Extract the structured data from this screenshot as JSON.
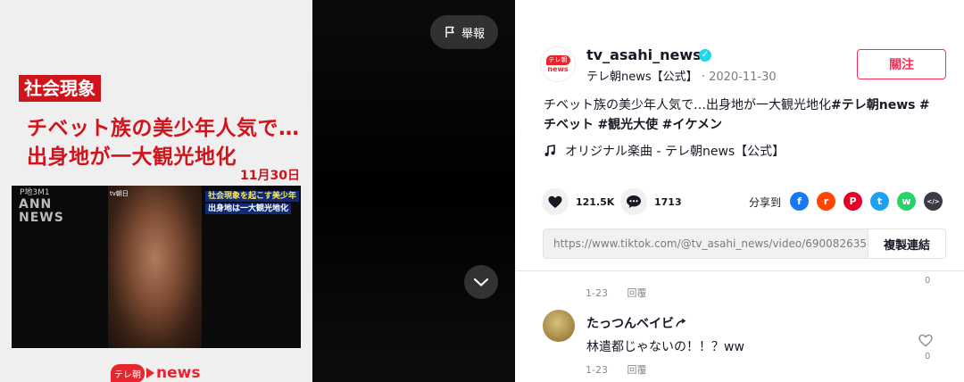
{
  "video": {
    "category": "社会現象",
    "title_line1": "チベット族の美少年人気で…",
    "title_line2": "出身地が一大観光地化",
    "date": "11月30日",
    "ann_mark": "P地3M1",
    "ann_logo": "ANN\nNEWS",
    "inner_caption_mark": "tv朝日",
    "inner_caption_1": "社会現象を起こす美少年",
    "inner_caption_2": "出身地は一大観光地化",
    "logo_badge": "テレ朝",
    "logo_news": "news",
    "report_label": "舉報"
  },
  "author": {
    "username": "tv_asahi_news",
    "nickname": "テレ朝news【公式】",
    "separator": " · ",
    "date": "2020-11-30",
    "avatar_badge": "テレ朝",
    "avatar_news": "news",
    "follow_label": "關注"
  },
  "caption": {
    "text": "チベット族の美少年人気で…出身地が一大観光地化",
    "hashtags_line1": [
      "#テレ朝news",
      "#"
    ],
    "line2": [
      "チベット",
      "#観光大使",
      "#イケメン"
    ]
  },
  "music": {
    "label": "オリジナル楽曲 - テレ朝news【公式】"
  },
  "stats": {
    "likes": "121.5K",
    "comments": "1713"
  },
  "share": {
    "label": "分享到",
    "icons": [
      {
        "name": "facebook-share-icon",
        "color": "#1877f2",
        "glyph": "f"
      },
      {
        "name": "reddit-share-icon",
        "color": "#ff4500",
        "glyph": "r"
      },
      {
        "name": "pinterest-share-icon",
        "color": "#e60023",
        "glyph": "P"
      },
      {
        "name": "twitter-share-icon",
        "color": "#1da1f2",
        "glyph": "t"
      },
      {
        "name": "whatsapp-share-icon",
        "color": "#25d366",
        "glyph": "w"
      },
      {
        "name": "embed-share-icon",
        "color": "#3a3b44",
        "glyph": "</>"
      }
    ]
  },
  "link": {
    "url": "https://www.tiktok.com/@tv_asahi_news/video/690082635...",
    "copy_label": "複製連結"
  },
  "comments": [
    {
      "date": "1-23",
      "reply_label": "回覆",
      "likes": "0"
    },
    {
      "name": "たっつんベイビ",
      "text": "林遣都じゃないの！！？ww",
      "date": "1-23",
      "reply_label": "回覆",
      "likes": "0"
    }
  ],
  "colors": {
    "accent": "#fe2c55",
    "brand_red": "#e8242c",
    "verified": "#20d5ec"
  }
}
